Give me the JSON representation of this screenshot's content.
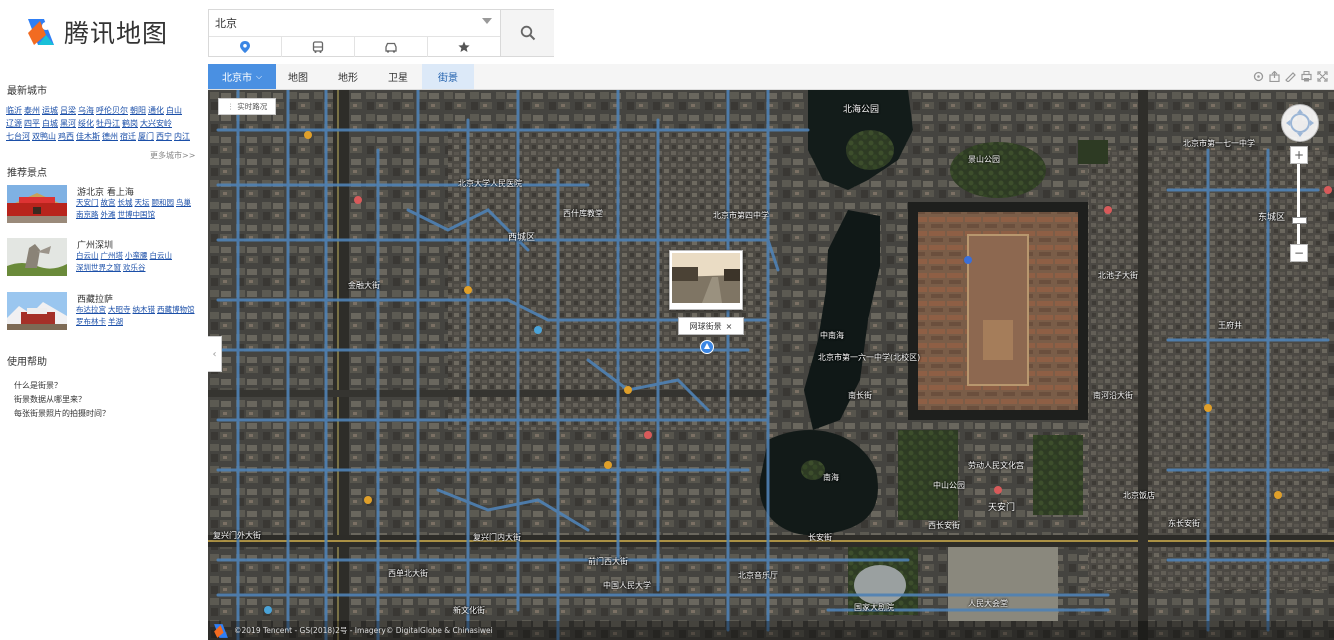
{
  "header": {
    "logo_text": "腾讯地图",
    "search_value": "北京",
    "mode_tabs": [
      {
        "name": "place",
        "icon": "location-pin-icon"
      },
      {
        "name": "bus",
        "icon": "bus-icon"
      },
      {
        "name": "drive",
        "icon": "car-icon"
      },
      {
        "name": "favorites",
        "icon": "star-icon"
      }
    ],
    "colors": {
      "accent": "#4a90e2",
      "brand_blue": "#2f7ff5",
      "brand_orange": "#f26b21"
    }
  },
  "sidebar": {
    "recent_cities_title": "最新城市",
    "cities": [
      "临沂",
      "泰州",
      "运城",
      "吕梁",
      "乌海",
      "呼伦贝尔",
      "朝阳",
      "通化",
      "白山",
      "辽源",
      "四平",
      "白城",
      "黑河",
      "绥化",
      "牡丹江",
      "鹤岗",
      "大兴安岭",
      "七台河",
      "双鸭山",
      "鸡西",
      "佳木斯",
      "德州",
      "宿迁",
      "厦门",
      "西宁",
      "内江"
    ],
    "more_cities": "更多城市>>",
    "recommend_title": "推荐景点",
    "recommend": [
      {
        "title": "游北京 看上海",
        "links": [
          "天安门",
          "故宫",
          "长城",
          "天坛",
          "颐和园",
          "鸟巢",
          "南京路",
          "外滩",
          "世博中国馆"
        ]
      },
      {
        "title": "广州深圳",
        "links": [
          "白云山",
          "广州塔",
          "小蛮腰",
          "白云山",
          "深圳世界之窗",
          "欢乐谷"
        ]
      },
      {
        "title": "西藏拉萨",
        "links": [
          "布达拉宫",
          "大昭寺",
          "纳木错",
          "西藏博物馆",
          "罗布林卡",
          "羊湖"
        ]
      }
    ],
    "help_title": "使用帮助",
    "help_items": [
      "什么是街景？",
      "街景数据从哪里来？",
      "每张街景照片的拍摄时间？"
    ]
  },
  "map": {
    "city_selector": "北京市",
    "map_types": [
      "地图",
      "地形",
      "卫星",
      "街景"
    ],
    "active_type": "街景",
    "realtime_label": "实时路况",
    "tools": [
      "locate-icon",
      "share-icon",
      "measure-icon",
      "print-icon",
      "fullscreen-icon"
    ],
    "zoom_level_fraction": 0.3,
    "streetview": {
      "title": "网球街景",
      "close": "×"
    },
    "copyright": "©2019 Tencent - GS(2018)2号 - Imagery© DigitalGlobe & Chinasiwei",
    "labels": [
      {
        "text": "北海公园"
      },
      {
        "text": "北京市第四中学"
      },
      {
        "text": "西什库教堂"
      },
      {
        "text": "景山公园"
      },
      {
        "text": "北京市第一六一中学(北校区)"
      },
      {
        "text": "中南海"
      },
      {
        "text": "南海"
      },
      {
        "text": "中山公园"
      },
      {
        "text": "长安街"
      },
      {
        "text": "国家大剧院"
      },
      {
        "text": "人民大会堂"
      },
      {
        "text": "中国人民大学"
      },
      {
        "text": "西单北大街"
      },
      {
        "text": "前门西大街"
      },
      {
        "text": "新文化街"
      },
      {
        "text": "北京音乐厅"
      },
      {
        "text": "劳动人民文化宫"
      },
      {
        "text": "北京大学人民医院"
      },
      {
        "text": "西城区"
      },
      {
        "text": "金融大街"
      },
      {
        "text": "复兴门外大街"
      },
      {
        "text": "复兴门内大街"
      },
      {
        "text": "西长安街"
      },
      {
        "text": "东长安街"
      },
      {
        "text": "天安门"
      },
      {
        "text": "南长街"
      },
      {
        "text": "北池子大街"
      },
      {
        "text": "王府井"
      },
      {
        "text": "东城区"
      },
      {
        "text": "南河沿大街"
      },
      {
        "text": "北京饭店"
      },
      {
        "text": "北京市第一七一中学"
      }
    ]
  }
}
